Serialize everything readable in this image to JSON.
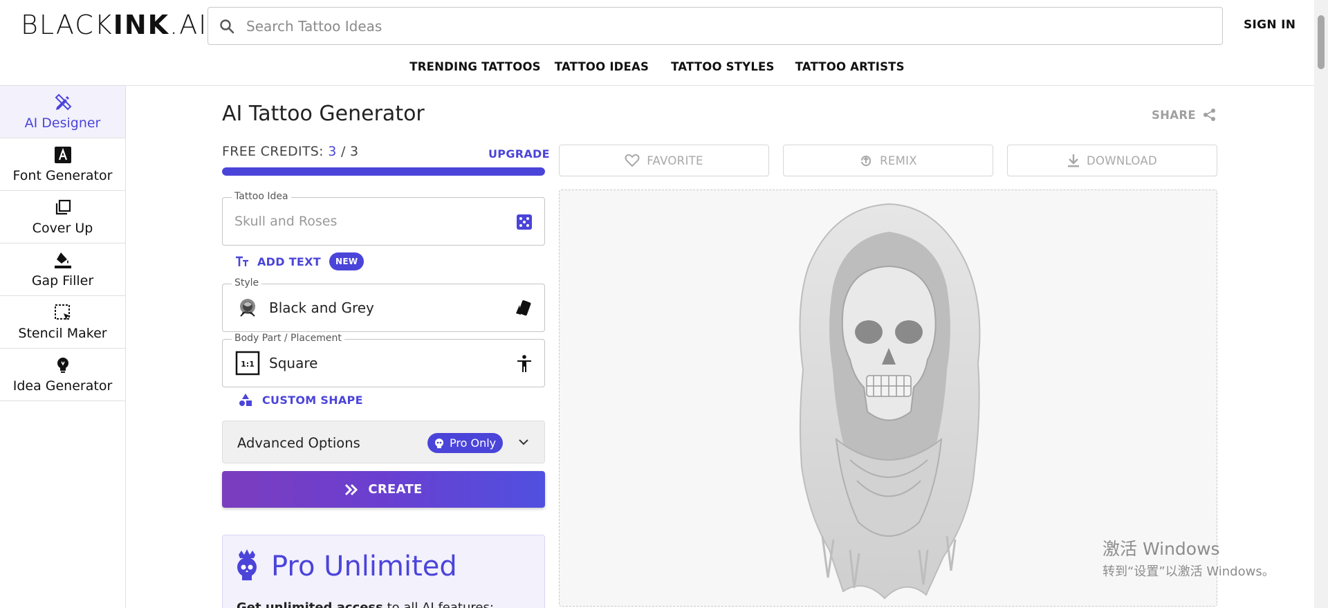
{
  "header": {
    "logo_light": "BLACK",
    "logo_bold": "INK",
    "logo_suffix": ".AI",
    "search_placeholder": "Search Tattoo Ideas",
    "sign_in": "SIGN IN"
  },
  "topnav": [
    "TRENDING TATTOOS",
    "TATTOO IDEAS",
    "TATTOO STYLES",
    "TATTOO ARTISTS"
  ],
  "sidebar": {
    "items": [
      {
        "label": "AI Designer",
        "icon": "pen-ruler-icon",
        "active": true
      },
      {
        "label": "Font Generator",
        "icon": "font-icon",
        "active": false
      },
      {
        "label": "Cover Up",
        "icon": "layers-icon",
        "active": false
      },
      {
        "label": "Gap Filler",
        "icon": "paint-bucket-icon",
        "active": false
      },
      {
        "label": "Stencil Maker",
        "icon": "select-cursor-icon",
        "active": false
      },
      {
        "label": "Idea Generator",
        "icon": "lightbulb-icon",
        "active": false
      }
    ]
  },
  "main": {
    "title": "AI Tattoo Generator",
    "share": "SHARE",
    "credits_label": "FREE CREDITS:",
    "credits_used": "3",
    "credits_sep": "/",
    "credits_total": "3",
    "credits_fraction": 1.0,
    "upgrade": "UPGRADE",
    "tattoo_idea_label": "Tattoo Idea",
    "tattoo_idea_placeholder": "Skull and Roses",
    "add_text": "ADD TEXT",
    "new_badge": "NEW",
    "style_label": "Style",
    "style_value": "Black and Grey",
    "placement_label": "Body Part / Placement",
    "placement_value": "Square",
    "placement_ratio": "1:1",
    "custom_shape": "CUSTOM SHAPE",
    "advanced_options": "Advanced Options",
    "pro_only": "Pro Only",
    "create": "CREATE",
    "pro_title": "Pro Unlimited",
    "pro_desc_bold": "Get unlimited access",
    "pro_desc_rest": " to all AI features:"
  },
  "actions": {
    "favorite": "FAVORITE",
    "remix": "REMIX",
    "download": "DOWNLOAD"
  },
  "watermark": {
    "line1": "激活 Windows",
    "line2": "转到“设置”以激活 Windows。"
  },
  "colors": {
    "accent": "#4b44d9",
    "create_gradient_start": "#7b3dbf",
    "create_gradient_end": "#5050e0"
  }
}
